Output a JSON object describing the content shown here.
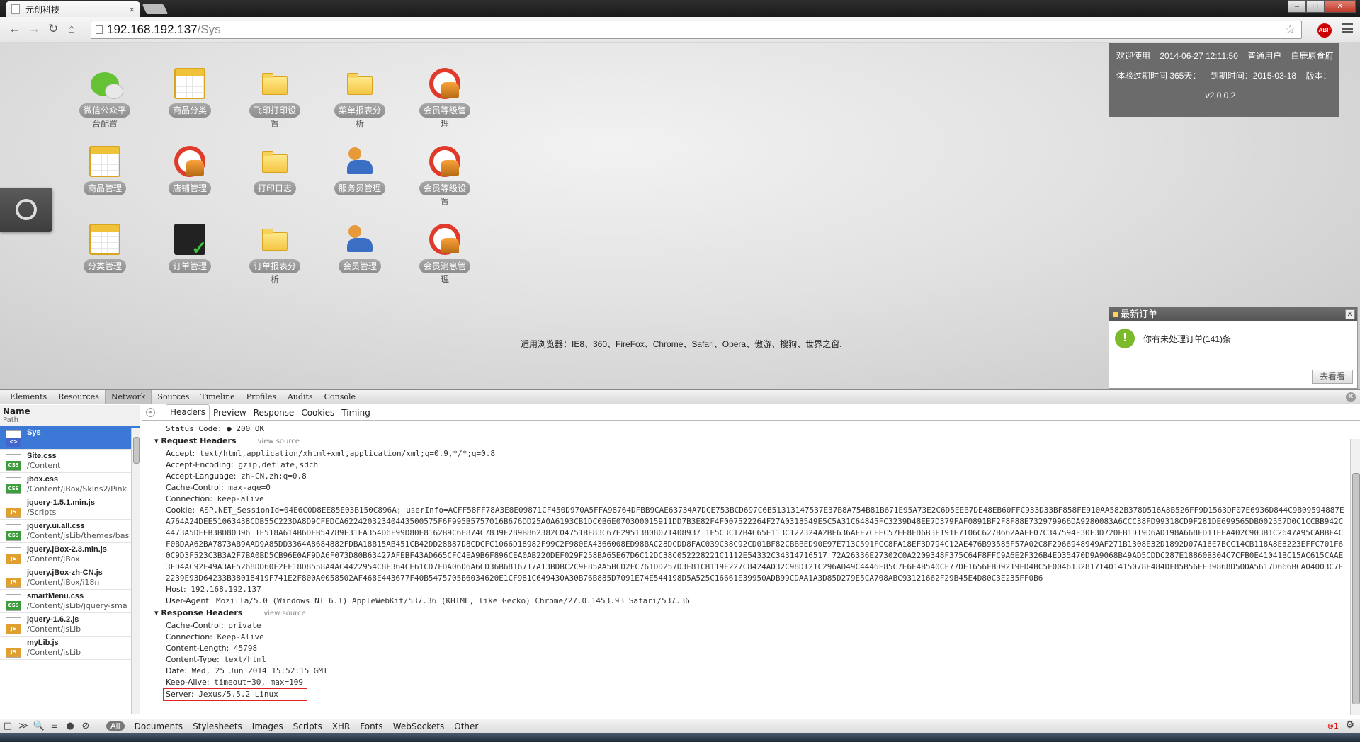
{
  "browser": {
    "tab_title": "元创科技",
    "tab_close": "×",
    "url_host": "192.168.192.137",
    "url_path": "/Sys",
    "abp": "ABP",
    "win_min": "–",
    "win_max": "□",
    "win_close": "✕",
    "back": "←",
    "forward": "→",
    "reload": "↻",
    "home": "⌂",
    "star": "☆"
  },
  "desktop": {
    "icons": [
      {
        "label": "微信公众平",
        "label2": "台配置",
        "icon": "wechat-icon"
      },
      {
        "label": "商品分类",
        "label2": "",
        "icon": "calendar-icon"
      },
      {
        "label": "飞印打印设",
        "label2": "置",
        "icon": "folder-icon"
      },
      {
        "label": "菜单报表分",
        "label2": "析",
        "icon": "folder-icon"
      },
      {
        "label": "会员等级管",
        "label2": "理",
        "icon": "lifebuoy-icon"
      },
      {
        "label": "商品管理",
        "label2": "",
        "icon": "calendar-icon"
      },
      {
        "label": "店铺管理",
        "label2": "",
        "icon": "lifebuoy-icon"
      },
      {
        "label": "打印日志",
        "label2": "",
        "icon": "folder-icon"
      },
      {
        "label": "服务员管理",
        "label2": "",
        "icon": "people-icon"
      },
      {
        "label": "会员等级设",
        "label2": "置",
        "icon": "lifebuoy-icon"
      },
      {
        "label": "分类管理",
        "label2": "",
        "icon": "calendar-icon"
      },
      {
        "label": "订单管理",
        "label2": "",
        "icon": "cart-check-icon"
      },
      {
        "label": "订单报表分",
        "label2": "析",
        "icon": "folder-icon"
      },
      {
        "label": "会员管理",
        "label2": "",
        "icon": "people-icon"
      },
      {
        "label": "会员消息管",
        "label2": "理",
        "icon": "lifebuoy-icon"
      }
    ],
    "browsers_note": "适用浏览器：IE8、360、FireFox、Chrome、Safari、Opera、傲游、搜狗、世界之窗."
  },
  "user_panel": {
    "welcome": "欢迎使用",
    "datetime": "2014-06-27 12:11:50",
    "role": "普通用户",
    "store": "白鹿原食府",
    "trial": "体验过期时间 365天：",
    "expire": "到期时间：2015-03-18",
    "version_label": "版本：",
    "version": "v2.0.0.2"
  },
  "order_popup": {
    "title": "最新订单",
    "close": "✕",
    "ok_glyph": "!",
    "message": "你有未处理订单(141)条",
    "go_button": "去看看"
  },
  "devtools": {
    "tabs": [
      "Elements",
      "Resources",
      "Network",
      "Sources",
      "Timeline",
      "Profiles",
      "Audits",
      "Console"
    ],
    "close": "✕",
    "list_header": "Name",
    "list_subheader": "Path",
    "requests": [
      {
        "name": "Sys",
        "path": "",
        "type": "doc",
        "type_label": "<>"
      },
      {
        "name": "Site.css",
        "path": "/Content",
        "type": "css",
        "type_label": "CSS"
      },
      {
        "name": "jbox.css",
        "path": "/Content/jBox/Skins2/Pink",
        "type": "css",
        "type_label": "CSS"
      },
      {
        "name": "jquery-1.5.1.min.js",
        "path": "/Scripts",
        "type": "js",
        "type_label": "JS"
      },
      {
        "name": "jquery.ui.all.css",
        "path": "/Content/jsLib/themes/bas",
        "type": "css",
        "type_label": "CSS"
      },
      {
        "name": "jquery.jBox-2.3.min.js",
        "path": "/Content/jBox",
        "type": "js",
        "type_label": "JS"
      },
      {
        "name": "jquery.jBox-zh-CN.js",
        "path": "/Content/jBox/i18n",
        "type": "js",
        "type_label": "JS"
      },
      {
        "name": "smartMenu.css",
        "path": "/Content/jsLib/jquery-sma",
        "type": "css",
        "type_label": "CSS"
      },
      {
        "name": "jquery-1.6.2.js",
        "path": "/Content/jsLib",
        "type": "js",
        "type_label": "JS"
      },
      {
        "name": "myLib.js",
        "path": "/Content/jsLib",
        "type": "js",
        "type_label": "JS"
      }
    ],
    "subtabs": [
      "Headers",
      "Preview",
      "Response",
      "Cookies",
      "Timing"
    ],
    "subtab_close": "×",
    "status_partial": "Status Code:  ● 200  OK",
    "request_headers_title": "Request Headers",
    "response_headers_title": "Response Headers",
    "view_source": "view source",
    "request_headers": [
      {
        "k": "Accept:",
        "v": "text/html,application/xhtml+xml,application/xml;q=0.9,*/*;q=0.8"
      },
      {
        "k": "Accept-Encoding:",
        "v": "gzip,deflate,sdch"
      },
      {
        "k": "Accept-Language:",
        "v": "zh-CN,zh;q=0.8"
      },
      {
        "k": "Cache-Control:",
        "v": "max-age=0"
      },
      {
        "k": "Connection:",
        "v": "keep-alive"
      }
    ],
    "cookie_key": "Cookie:",
    "cookie_value": "ASP.NET_SessionId=04E6C0D8EE85E03B150C896A; userInfo=ACFF58FF78A3E8E09871CF450D970A5FFA98764DFBB9CAE63734A7DCE753BCD697C6B51313147537E37B8A754B81B671E95A73E2C6D5EEB7DE48EB60FFC933D33BF858FE910AA582B378D516A8B526FF9D1563DF07E6936D844C9B09594887EA764A24DEE51063438CDB55C223DA8D9CFEDCA62242032340443500575F6F995B5757016B676DD25A0A6193CB1DC0B6E070300015911DD7B3E82F4F007522264F27A0318549E5C5A31C64845FC3239D48EE7D379FAF0891BF2F8F88E732979966DA9280083A6CCC38FD99318CD9F281DE699565DB002557D0C1CCBB942C4473A5DFEB3BD80396 1E518A614B6DFB54789F31FA354D6F99D80E8162B9C6E874C7839F289B862382C04751BF83C67E29513808071408937 1F5C3C17B4C65E113C122324A2BF636AFE7CEEC57EE8FD6B3F191E7106C627B662AAFF07C347594F30F3D720EB1D19D6AD198A668FD11EEA402C903B1C2647A95CABBF4CF0BDAA62BA7873AB9AAD9A85DD3364A8684882FDBA18B15AB451CB42DD28B87D8CDCFC1066D18982F99C2F980EA4366008ED98BAC28DCDD8FAC039C38C92CD01BF82CBBBED90E97E713C591FCC8FA18EF3D794C12AE476B93585F57A02C8F2966948949AF271B1308E32D1892D07A16E7BCC14CB118A8E8223EFFC701F60C9D3F523C3B3A2F7BA0BD5CB96E0AF9DA6F073D80B63427AFEBF43AD665CFC4EA9B6F896CEA0AB220DEF029F258BA65E67D6C12DC38C052228221C1112E54332C34314716517 72A26336E27302C0A2209348F375C64F8FFC9A6E2F326B4ED35470D9A9068B49AD5CDDC287E18860B304C7CFB0E41041BC15AC615CAAE3FD4AC92F49A3AF5268DD60F2FF18D8558A4AC4422954C8F364CE61CD7FDA06D6A6CD36B6816717A13BDBC2C9F85AA5BCD2FC761DD257D3F81CB119E227C8424AD32C98D121C296AD49C4446F85C7E6F4B540CF77DE1656FBD9219FD4BC5F00461328171401415078F484DF85B56EE39868D50DA5617D666BCA04003C7E2239E93D64233B38018419F741E2F800A0058502AF468E443677F40B5475705B6034620E1CF981C649430A30B76B885D7091E74E544198D5A525C16661E39950ADB99CDAA1A3D85D279E5CA708ABC93121662F29B45E4D80C3E235FF0B6",
    "host": {
      "k": "Host:",
      "v": "192.168.192.137"
    },
    "user_agent": {
      "k": "User-Agent:",
      "v": "Mozilla/5.0 (Windows NT 6.1) AppleWebKit/537.36 (KHTML, like Gecko) Chrome/27.0.1453.93 Safari/537.36"
    },
    "response_headers": [
      {
        "k": "Cache-Control:",
        "v": "private"
      },
      {
        "k": "Connection:",
        "v": "Keep-Alive"
      },
      {
        "k": "Content-Length:",
        "v": "45798"
      },
      {
        "k": "Content-Type:",
        "v": "text/html"
      },
      {
        "k": "Date:",
        "v": "Wed, 25 Jun 2014 15:52:15 GMT"
      },
      {
        "k": "Keep-Alive:",
        "v": "timeout=30, max=109"
      }
    ],
    "server": {
      "k": "Server:",
      "v": "Jexus/5.5.2 Linux"
    },
    "filters": [
      "Documents",
      "Stylesheets",
      "Images",
      "Scripts",
      "XHR",
      "Fonts",
      "WebSockets",
      "Other"
    ],
    "filter_all": "All",
    "bottom_icons": [
      "□",
      "≫",
      "🔍",
      "≡",
      "●",
      "⊘"
    ],
    "error_count": "⊗1",
    "gear": "⚙"
  }
}
